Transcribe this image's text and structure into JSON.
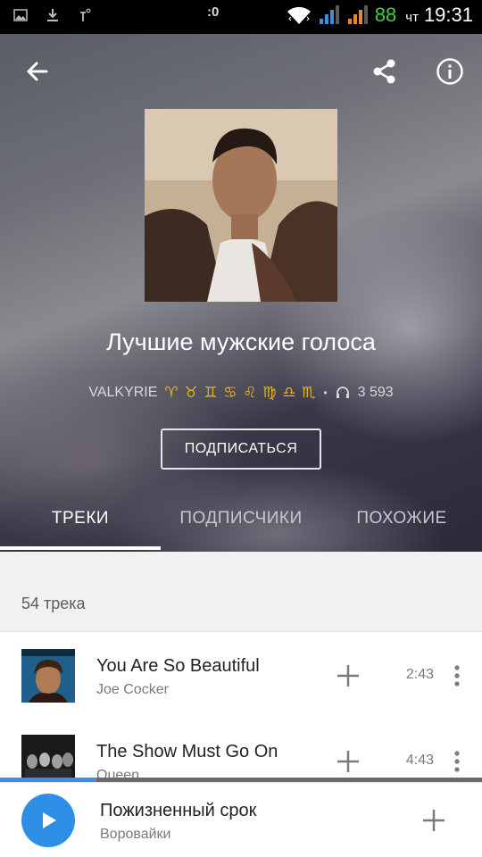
{
  "status_bar": {
    "center_text": ":0",
    "battery": "88",
    "day": "чт",
    "time": "19:31",
    "icons": [
      "image-icon",
      "download-icon",
      "temperature-icon",
      "wifi-icon",
      "signal-icon",
      "signal-icon"
    ]
  },
  "playlist": {
    "title": "Лучшие мужские голоса",
    "author": "VALKYRIE",
    "author_symbols": "♈ ♉ ♊ ♋ ♌ ♍ ♎ ♏",
    "separator": "•",
    "listens": "3 593",
    "subscribe_label": "ПОДПИСАТЬСЯ"
  },
  "tabs": [
    {
      "label": "ТРЕКИ",
      "active": true
    },
    {
      "label": "ПОДПИСЧИКИ",
      "active": false
    },
    {
      "label": "ПОХОЖИЕ",
      "active": false
    }
  ],
  "track_count": "54 трека",
  "tracks": [
    {
      "title": "You Are So Beautiful",
      "artist": "Joe Cocker",
      "duration": "2:43"
    },
    {
      "title": "The Show Must Go On",
      "artist": "Queen",
      "duration": "4:43"
    }
  ],
  "now_playing": {
    "title": "Пожизненный срок",
    "artist": "Воровайки",
    "progress": 0.2
  },
  "colors": {
    "accent": "#2d8fe6",
    "zodiac": "#e6b41e",
    "battery": "#3fd13f"
  }
}
